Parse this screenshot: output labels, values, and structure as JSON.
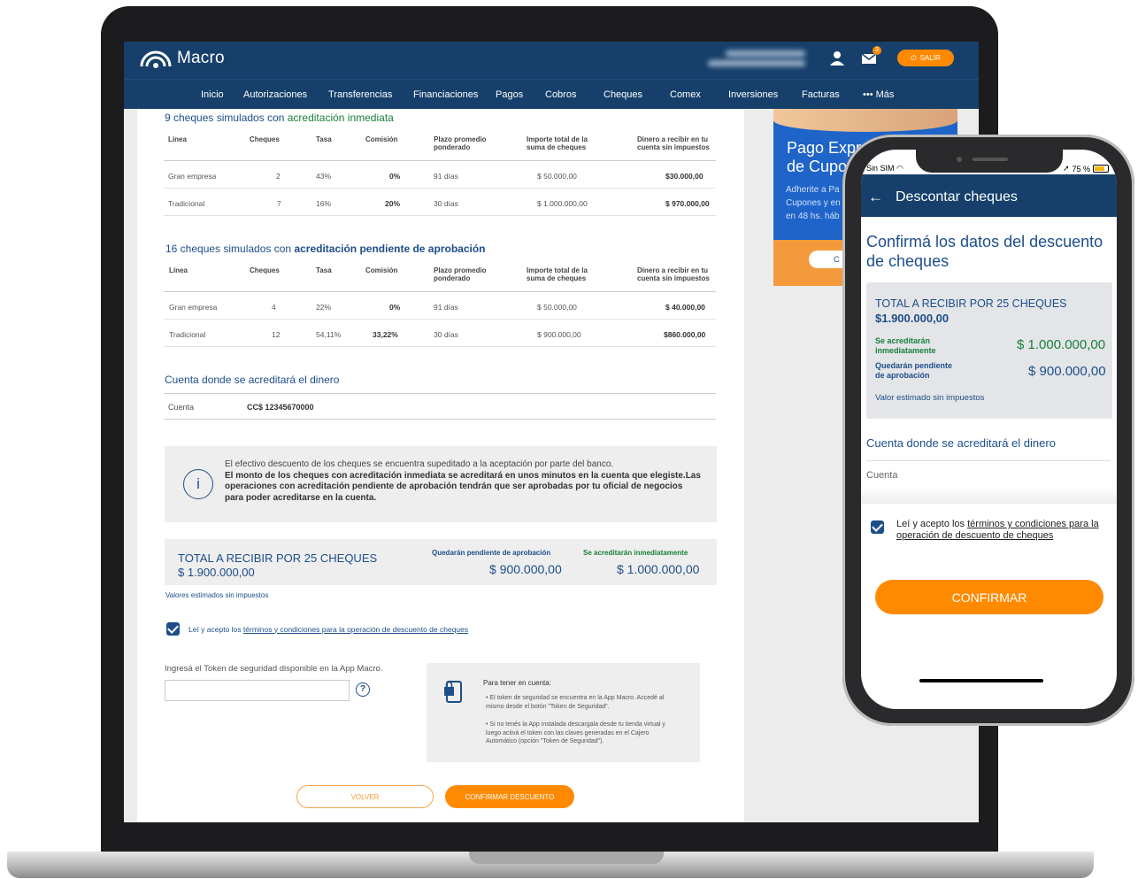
{
  "desktop": {
    "brand": "Macro",
    "salir_label": "SALIR",
    "mail_badge": "3",
    "nav": [
      "Inicio",
      "Autorizaciones",
      "Transferencias",
      "Financiaciones",
      "Pagos",
      "Cobros",
      "Cheques",
      "Comex",
      "Inversiones",
      "Facturas",
      "••• Más"
    ],
    "section1": {
      "prefix": "9 cheques simulados con ",
      "highlight": "acreditación inmediata",
      "headers": [
        "Línea",
        "Cheques",
        "Tasa",
        "Comisión",
        "Plazo promedio ponderado",
        "Importe total de la suma de cheques",
        "Dinero a recibir en tu cuenta sin impuestos"
      ],
      "rows": [
        [
          "Gran empresa",
          "2",
          "43%",
          "0%",
          "91 días",
          "$ 50.000,00",
          "$30.000,00"
        ],
        [
          "Tradicional",
          "7",
          "16%",
          "20%",
          "30 días",
          "$ 1.000.000,00",
          "$ 970.000,00"
        ]
      ]
    },
    "section2": {
      "prefix": "16 cheques simulados con ",
      "highlight": "acreditación pendiente de aprobación",
      "headers": [
        "Línea",
        "Cheques",
        "Tasa",
        "Comisión",
        "Plazo promedio ponderado",
        "Importe total de la suma de cheques",
        "Dinero a recibir en tu cuenta sin impuestos"
      ],
      "rows": [
        [
          "Gran empresa",
          "4",
          "22%",
          "0%",
          "91 días",
          "$ 50.000,00",
          "$ 40.000,00"
        ],
        [
          "Tradicional",
          "12",
          "54,11%",
          "33,22%",
          "30 días",
          "$ 900.000,00",
          "$860.000,00"
        ]
      ]
    },
    "cuenta_title": "Cuenta donde se acreditará el dinero",
    "cuenta_label": "Cuenta",
    "cuenta_value": "CC$ 12345670000",
    "info_text_1": "El efectivo descuento de los cheques se encuentra supeditado a la aceptación por parte del banco.",
    "info_text_2": "El monto de los cheques con acreditación inmediata se acreditará en unos minutos en la cuenta que elegiste.Las operaciones con acreditación pendiente de aprobación tendrán que ser aprobadas por tu oficial de negocios para poder acreditarse en la cuenta.",
    "total_title": "TOTAL A RECIBIR POR 25 CHEQUES",
    "total_amount": "$ 1.900.000,00",
    "pendiente_label": "Quedarán pendiente de aprobación",
    "pendiente_amount": "$ 900.000,00",
    "inmediata_label": "Se acreditarán inmediatamente",
    "inmediata_amount": "$ 1.000.000,00",
    "valores_note": "Valores estimados sin impuestos",
    "terms_prefix": "Leí y acepto los ",
    "terms_link": "términos y condiciones para la operación de descuento de cheques",
    "token_label": "Ingresá el Token de seguridad disponible en la App Macro.",
    "token_placeholder": "",
    "tip_title": "Para tener en cuenta:",
    "tip_1": "• El token de seguridad se encuentra en la App Macro. Accedé al mismo desde el botón \"Token de Seguridad\".",
    "tip_2": "• Si no tenés la App instalada descargala desde tu tienda virtual y luego activá el token con las claves generadas en el Cajero Automático (opción \"Token de Seguridad\").",
    "volver_label": "VOLVER",
    "confirmar_label": "CONFIRMAR DESCUENTO",
    "banner_title": "Pago Expr",
    "banner_title2": "de Cupor",
    "banner_text": "Adherite a Pa",
    "banner_text2": "Cupones y en",
    "banner_text3": "en 48 hs. háb",
    "banner_btn": "C"
  },
  "mobile": {
    "carrier": "Sin SIM",
    "battery": "75 %",
    "header_title": "Descontar cheques",
    "heading": "Confirmá los datos del descuento de cheques",
    "total_title": "TOTAL A RECIBIR POR 25 CHEQUES",
    "total_amount": "$1.900.000,00",
    "inmediata_label": "Se acreditarán inmediatamente",
    "inmediata_amount": "$ 1.000.000,00",
    "pendiente_label": "Quedarán pendiente de aprobación",
    "pendiente_amount": "$ 900.000,00",
    "note": "Valor estimado sin impuestos",
    "cuenta_title": "Cuenta donde se acreditará el dinero",
    "cuenta_label": "Cuenta",
    "terms_prefix": "Leí y acepto los ",
    "terms_link": "términos y condiciones para la operación de descuento de cheques",
    "confirm_label": "CONFIRMAR"
  },
  "colors": {
    "navy": "#16406b",
    "orange": "#ff8a00",
    "green": "#197e3a",
    "blue": "#1d4e89"
  }
}
